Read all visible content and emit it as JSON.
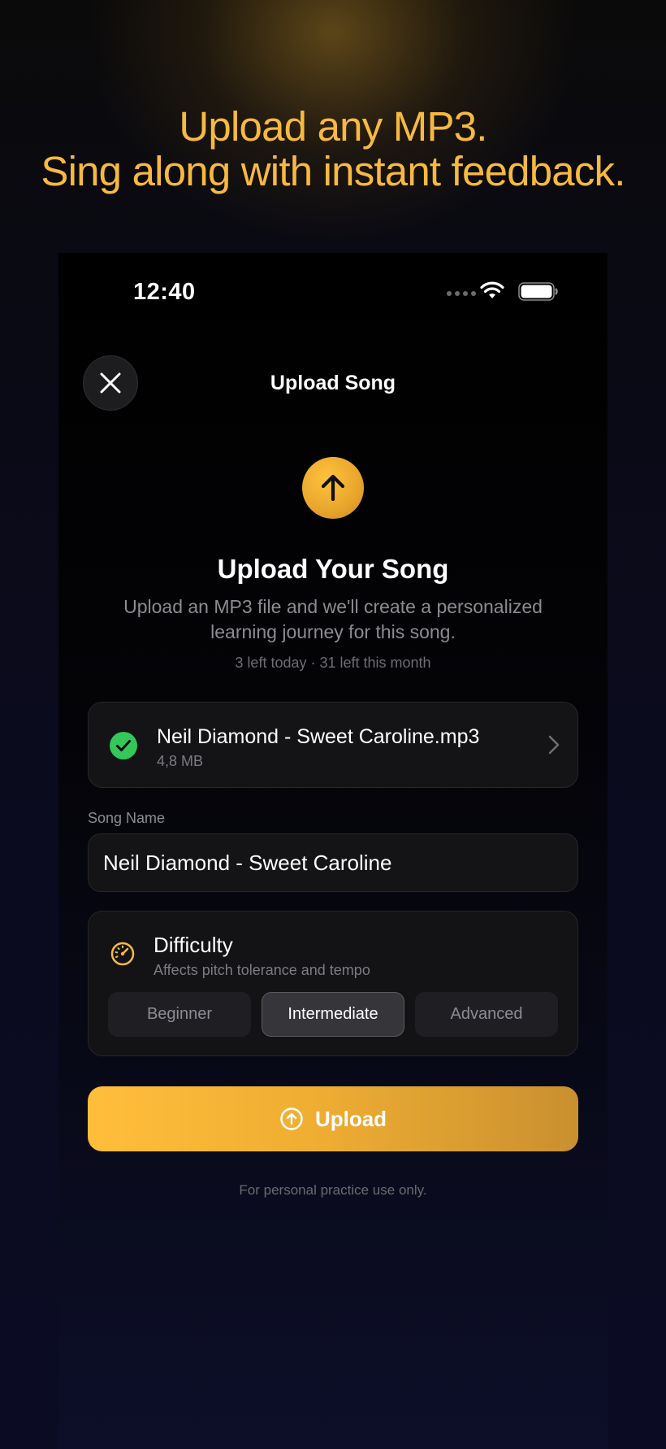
{
  "headline": {
    "line1": "Upload any MP3.",
    "line2": "Sing along with instant feedback."
  },
  "status_bar": {
    "time": "12:40"
  },
  "nav": {
    "title": "Upload Song"
  },
  "hero": {
    "title": "Upload Your Song",
    "description": "Upload an MP3 file and we'll create a personalized learning journey for this song.",
    "quota": "3 left today · 31 left this month"
  },
  "file": {
    "name": "Neil Diamond - Sweet Caroline.mp3",
    "size": "4,8 MB"
  },
  "song_name": {
    "label": "Song Name",
    "value": "Neil Diamond - Sweet Caroline"
  },
  "difficulty": {
    "title": "Difficulty",
    "subtitle": "Affects pitch tolerance and tempo",
    "options": [
      "Beginner",
      "Intermediate",
      "Advanced"
    ],
    "selected": "Intermediate"
  },
  "upload_button": {
    "label": "Upload"
  },
  "footnote": "For personal practice use only.",
  "colors": {
    "accent": "#f7b93f",
    "success": "#34c759",
    "background": "#000000"
  }
}
